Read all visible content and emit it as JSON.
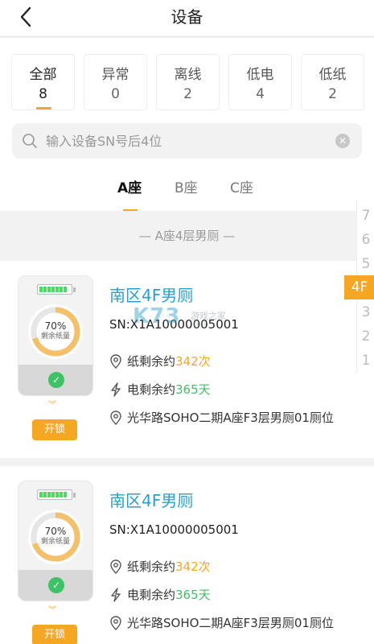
{
  "header": {
    "title": "设备"
  },
  "filters": [
    {
      "label": "全部",
      "count": "8"
    },
    {
      "label": "异常",
      "count": "0"
    },
    {
      "label": "离线",
      "count": "2"
    },
    {
      "label": "低电",
      "count": "4"
    },
    {
      "label": "低纸",
      "count": "2"
    }
  ],
  "search": {
    "placeholder": "输入设备SN号后4位",
    "value": ""
  },
  "building_tabs": [
    "A座",
    "B座",
    "C座"
  ],
  "section_title": "— A座4层男厕 —",
  "floor_index": [
    "7",
    "6",
    "5",
    "4F",
    "3",
    "2",
    "1"
  ],
  "devices": [
    {
      "name": "南区4F男厕",
      "sn": "SN:X1A10000005001",
      "percent": "70%",
      "percent_label": "剩余纸量",
      "paper_fraction": 0.7,
      "paper_prefix": "纸剩余约",
      "paper_value": "342次",
      "power_prefix": "电剩余约",
      "power_value": "365天",
      "address": "光华路SOHO二期A座F3层男厕01厕位",
      "unlock_label": "开锁"
    },
    {
      "name": "南区4F男厕",
      "sn": "SN:X1A10000005001",
      "percent": "70%",
      "percent_label": "剩余纸量",
      "paper_fraction": 0.7,
      "paper_prefix": "纸剩余约",
      "paper_value": "342次",
      "power_prefix": "电剩余约",
      "power_value": "365天",
      "address": "光华路SOHO二期A座F3层男厕01厕位",
      "unlock_label": "开锁"
    }
  ],
  "watermark": {
    "brand": "K73",
    "line1": "游戏之家",
    "line2": ".com"
  },
  "colors": {
    "accent": "#f5a623",
    "title_blue": "#2aa0c8",
    "success": "#3ec266"
  },
  "icons": {
    "back": "chevron-left-icon",
    "search": "search-icon",
    "clear": "clear-icon",
    "location": "location-pin-icon",
    "power": "lightning-icon",
    "check": "check-circle-icon"
  }
}
